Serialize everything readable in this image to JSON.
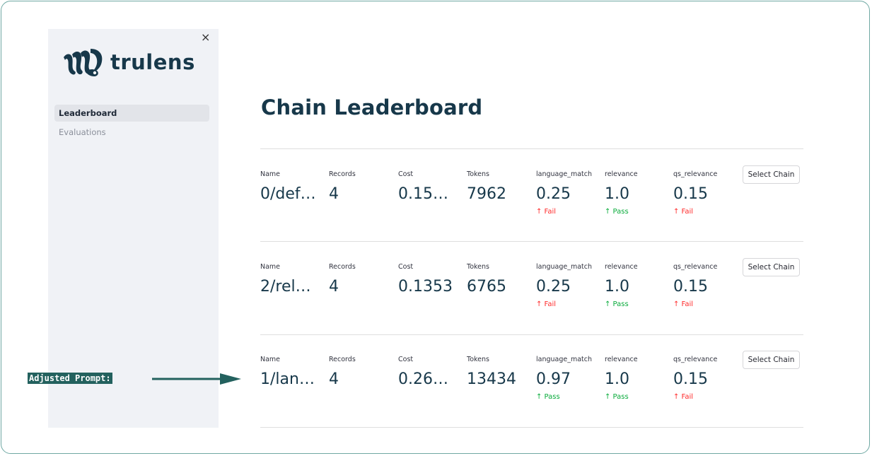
{
  "sidebar": {
    "close_glyph": "×",
    "logo_text": "trulens",
    "nav": [
      {
        "label": "Leaderboard",
        "active": true
      },
      {
        "label": "Evaluations",
        "active": false
      }
    ]
  },
  "main": {
    "title": "Chain Leaderboard",
    "columns": [
      "Name",
      "Records",
      "Cost",
      "Tokens",
      "language_match",
      "relevance",
      "qs_relevance"
    ],
    "rows": [
      {
        "name": "0/def…",
        "records": "4",
        "cost": "0.15…",
        "tokens": "7962",
        "language_match": {
          "value": "0.25",
          "delta": "↑ Fail",
          "status": "fail"
        },
        "relevance": {
          "value": "1.0",
          "delta": "↑ Pass",
          "status": "pass"
        },
        "qs_relevance": {
          "value": "0.15",
          "delta": "↑ Fail",
          "status": "fail"
        },
        "button": "Select Chain"
      },
      {
        "name": "2/rel…",
        "records": "4",
        "cost": "0.1353",
        "tokens": "6765",
        "language_match": {
          "value": "0.25",
          "delta": "↑ Fail",
          "status": "fail"
        },
        "relevance": {
          "value": "1.0",
          "delta": "↑ Pass",
          "status": "pass"
        },
        "qs_relevance": {
          "value": "0.15",
          "delta": "↑ Fail",
          "status": "fail"
        },
        "button": "Select Chain"
      },
      {
        "name": "1/lan…",
        "records": "4",
        "cost": "0.26…",
        "tokens": "13434",
        "language_match": {
          "value": "0.97",
          "delta": "↑ Pass",
          "status": "pass"
        },
        "relevance": {
          "value": "1.0",
          "delta": "↑ Pass",
          "status": "pass"
        },
        "qs_relevance": {
          "value": "0.15",
          "delta": "↑ Fail",
          "status": "fail"
        },
        "button": "Select Chain"
      }
    ]
  },
  "annotation": {
    "label": "Adjusted Prompt:"
  },
  "colors": {
    "brand": "#17384a",
    "pass": "#09ab3b",
    "fail": "#ff2b2b",
    "annotation_bg": "#23615e",
    "sidebar_bg": "#f0f2f6",
    "frame_border": "#6fa8a3"
  },
  "icons": {
    "logo": "trulens-squid-logo",
    "close": "close-icon",
    "arrow": "right-arrow-icon"
  }
}
